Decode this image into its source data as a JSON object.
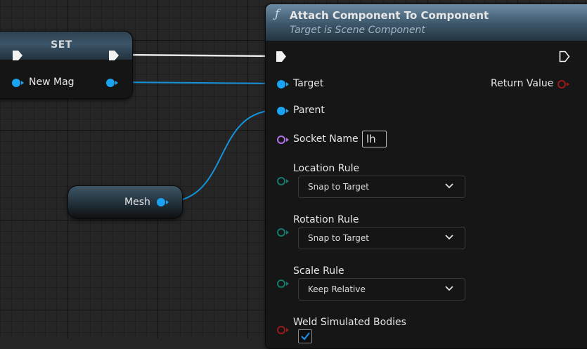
{
  "set_node": {
    "title": "SET",
    "input_label": "New Mag"
  },
  "mesh_node": {
    "label": "Mesh"
  },
  "attach_node": {
    "function_icon": "ƒ",
    "title": "Attach Component To Component",
    "subtitle": "Target is Scene Component",
    "pins": {
      "target": "Target",
      "parent": "Parent",
      "socket_name": "Socket Name",
      "socket_value": "lh",
      "return_value": "Return Value",
      "location_rule": "Location Rule",
      "rotation_rule": "Rotation Rule",
      "scale_rule": "Scale Rule",
      "weld": "Weld Simulated Bodies"
    },
    "dropdowns": {
      "location": "Snap to Target",
      "rotation": "Snap to Target",
      "scale": "Keep Relative"
    },
    "weld_checked": true
  },
  "colors": {
    "background": "#262626",
    "object_pin": "#1aa3f0",
    "name_pin": "#b273e8",
    "enum_pin": "#147a6c",
    "bool_pin": "#9a1a1a",
    "exec_wire": "#ffffff"
  },
  "icons": [
    "exec-pin-icon",
    "object-pin-icon",
    "function-icon",
    "chevron-down-icon",
    "checkmark-icon"
  ]
}
